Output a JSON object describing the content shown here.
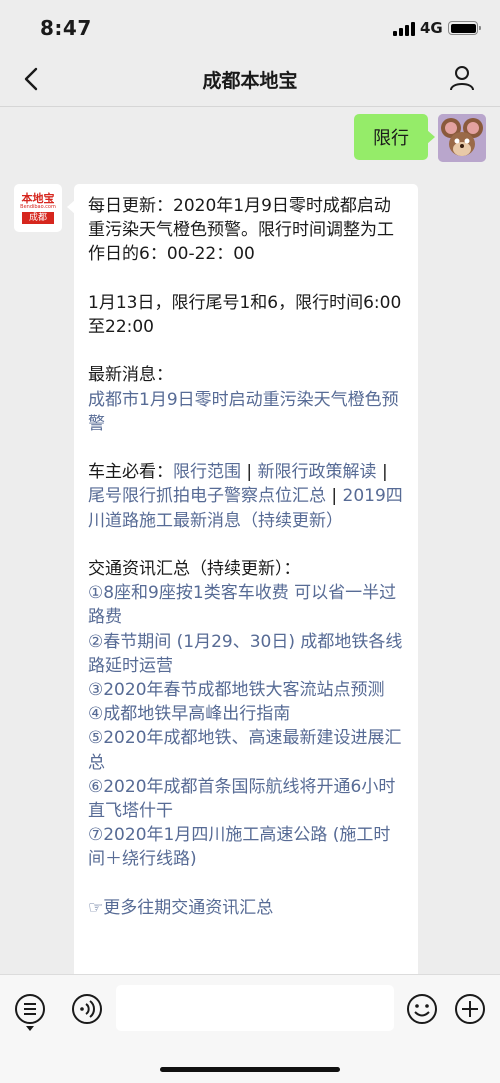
{
  "status_bar": {
    "time": "8:47",
    "network": "4G"
  },
  "nav": {
    "title": "成都本地宝"
  },
  "sent_message": {
    "text": "限行"
  },
  "bot_avatar": {
    "logo_text": "本地宝",
    "logo_sub": "Bendibao.com",
    "logo_city": "成都"
  },
  "reply": {
    "intro": "每日更新：2020年1月9日零时成都启动重污染天气橙色预警。限行时间调整为工作日的6：00-22：00",
    "today": "1月13日，限行尾号1和6，限行时间6:00至22:00",
    "news_label": "最新消息：",
    "news_link": "成都市1月9日零时启动重污染天气橙色预警",
    "owners_label": "车主必看：",
    "owners_links": [
      "限行范围",
      "新限行政策解读",
      "尾号限行抓拍电子警察点位汇总",
      "2019四川道路施工最新消息（持续更新）"
    ],
    "separator": " | ",
    "traffic_label": "交通资讯汇总（持续更新）：",
    "traffic_items": [
      "①8座和9座按1类客车收费 可以省一半过路费",
      "②春节期间 (1月29、30日) 成都地铁各线路延时运营",
      "③2020年春节成都地铁大客流站点预测",
      "④成都地铁早高峰出行指南",
      "⑤2020年成都地铁、高速最新建设进展汇总",
      "⑥2020年成都首条国际航线将开通6小时直飞塔什干",
      "⑦2020年1月四川施工高速公路 (施工时间＋绕行线路)"
    ],
    "more_link": "☞更多往期交通资讯汇总"
  },
  "input_bar": {
    "text": ""
  }
}
